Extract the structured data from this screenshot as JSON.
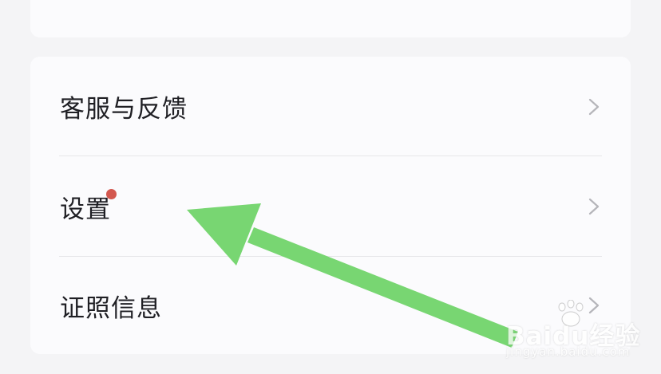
{
  "menu": {
    "items": [
      {
        "label": "客服与反馈",
        "has_badge": false
      },
      {
        "label": "设置",
        "has_badge": true
      },
      {
        "label": "证照信息",
        "has_badge": false
      }
    ]
  },
  "icons": {
    "chevron": "chevron-right-icon",
    "badge": "red-dot-badge"
  },
  "annotation": {
    "type": "arrow",
    "color": "#78d672",
    "points_to": "设置"
  },
  "watermark": {
    "brand": "Baidu经验",
    "url": "jingyan.baidu.com"
  },
  "colors": {
    "page_bg": "#f4f4f6",
    "card_bg": "#fbfbfd",
    "text": "#1f1f24",
    "divider": "#e6e6e9",
    "chevron": "#b5b5ba",
    "badge": "#d3584f"
  }
}
